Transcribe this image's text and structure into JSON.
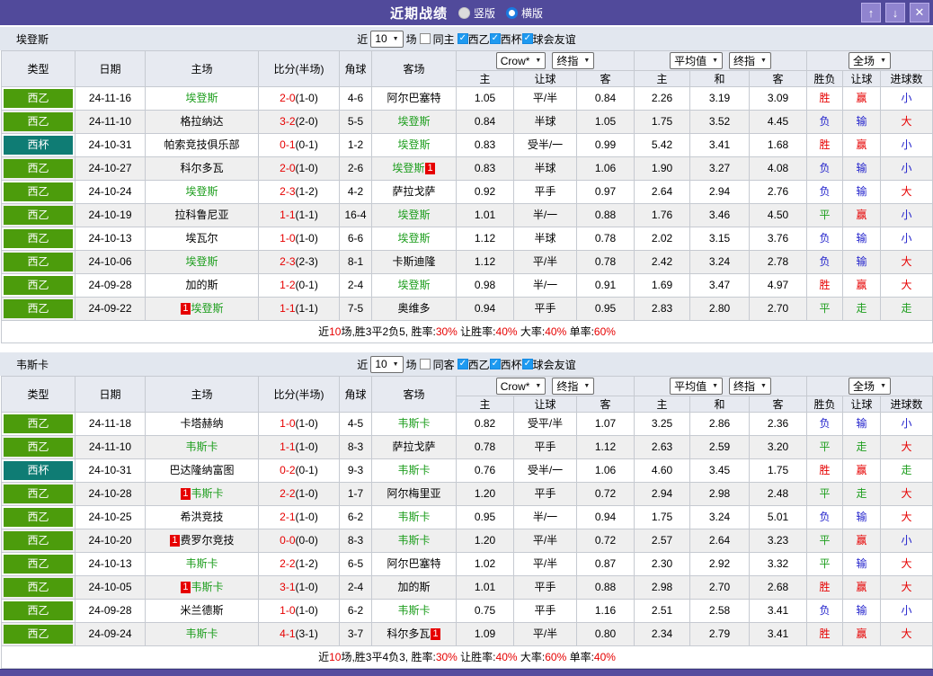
{
  "window": {
    "title": "近期战绩",
    "layout_options": [
      {
        "label": "竖版",
        "selected": false
      },
      {
        "label": "横版",
        "selected": true
      }
    ],
    "buttons": {
      "up": "↑",
      "down": "↓",
      "close": "✕"
    }
  },
  "header_labels": {
    "type": "类型",
    "date": "日期",
    "home": "主场",
    "score": "比分(半场)",
    "corner": "角球",
    "away": "客场",
    "odds_home": "主",
    "odds_handicap": "让球",
    "odds_away": "客",
    "avg_home": "主",
    "avg_draw": "和",
    "avg_away": "客",
    "result": "胜负",
    "handicap": "让球",
    "goals": "进球数"
  },
  "colors": {
    "accent_purple": "#514a9b",
    "league_green": "#4c9c0c",
    "cup_teal": "#0f7c74",
    "win_red": "#e60000",
    "draw_green": "#1e9e1e",
    "lose_blue": "#2323cc",
    "odds_bg": "#fdf8f1",
    "avg_bg": "#e9f4fa",
    "checkbox_blue": "#1e9af0"
  },
  "tables": [
    {
      "team": "埃登斯",
      "filter": {
        "near": "近",
        "count": "10",
        "matches": "场",
        "same": {
          "label": "同主",
          "checked": false
        },
        "leagues": [
          {
            "label": "西乙",
            "checked": true
          },
          {
            "label": "西杯",
            "checked": true
          },
          {
            "label": "球会友谊",
            "checked": true
          }
        ]
      },
      "selects": {
        "odds_company": "Crow*",
        "odds_time": "终指",
        "avg_source": "平均值",
        "avg_time": "终指",
        "scope": "全场"
      },
      "rows": [
        {
          "type": "西乙",
          "cup": false,
          "date": "24-11-16",
          "home": "埃登斯",
          "home_green": true,
          "away": "阿尔巴塞特",
          "away_green": false,
          "score": "2-0",
          "half": "(1-0)",
          "corner": "4-6",
          "odds": [
            "1.05",
            "平/半",
            "0.84"
          ],
          "avg": [
            "2.26",
            "3.19",
            "3.09"
          ],
          "results": [
            [
              "胜",
              "r"
            ],
            [
              "赢",
              "r"
            ],
            [
              "小",
              "b"
            ]
          ]
        },
        {
          "type": "西乙",
          "cup": false,
          "date": "24-11-10",
          "home": "格拉纳达",
          "home_green": false,
          "away": "埃登斯",
          "away_green": true,
          "score": "3-2",
          "half": "(2-0)",
          "corner": "5-5",
          "odds": [
            "0.84",
            "半球",
            "1.05"
          ],
          "avg": [
            "1.75",
            "3.52",
            "4.45"
          ],
          "results": [
            [
              "负",
              "b"
            ],
            [
              "输",
              "b"
            ],
            [
              "大",
              "r"
            ]
          ]
        },
        {
          "type": "西杯",
          "cup": true,
          "date": "24-10-31",
          "home": "帕索竞技俱乐部",
          "home_green": false,
          "away": "埃登斯",
          "away_green": true,
          "score": "0-1",
          "half": "(0-1)",
          "corner": "1-2",
          "odds": [
            "0.83",
            "受半/一",
            "0.99"
          ],
          "avg": [
            "5.42",
            "3.41",
            "1.68"
          ],
          "results": [
            [
              "胜",
              "r"
            ],
            [
              "赢",
              "r"
            ],
            [
              "小",
              "b"
            ]
          ]
        },
        {
          "type": "西乙",
          "cup": false,
          "date": "24-10-27",
          "home": "科尔多瓦",
          "home_green": false,
          "away": "埃登斯",
          "away_green": true,
          "away_card_post": "1",
          "score": "2-0",
          "half": "(1-0)",
          "corner": "2-6",
          "odds": [
            "0.83",
            "半球",
            "1.06"
          ],
          "avg": [
            "1.90",
            "3.27",
            "4.08"
          ],
          "results": [
            [
              "负",
              "b"
            ],
            [
              "输",
              "b"
            ],
            [
              "小",
              "b"
            ]
          ]
        },
        {
          "type": "西乙",
          "cup": false,
          "date": "24-10-24",
          "home": "埃登斯",
          "home_green": true,
          "away": "萨拉戈萨",
          "away_green": false,
          "score": "2-3",
          "half": "(1-2)",
          "corner": "4-2",
          "odds": [
            "0.92",
            "平手",
            "0.97"
          ],
          "avg": [
            "2.64",
            "2.94",
            "2.76"
          ],
          "results": [
            [
              "负",
              "b"
            ],
            [
              "输",
              "b"
            ],
            [
              "大",
              "r"
            ]
          ]
        },
        {
          "type": "西乙",
          "cup": false,
          "date": "24-10-19",
          "home": "拉科鲁尼亚",
          "home_green": false,
          "away": "埃登斯",
          "away_green": true,
          "score": "1-1",
          "half": "(1-1)",
          "corner": "16-4",
          "odds": [
            "1.01",
            "半/一",
            "0.88"
          ],
          "avg": [
            "1.76",
            "3.46",
            "4.50"
          ],
          "results": [
            [
              "平",
              "g"
            ],
            [
              "赢",
              "r"
            ],
            [
              "小",
              "b"
            ]
          ]
        },
        {
          "type": "西乙",
          "cup": false,
          "date": "24-10-13",
          "home": "埃瓦尔",
          "home_green": false,
          "away": "埃登斯",
          "away_green": true,
          "score": "1-0",
          "half": "(1-0)",
          "corner": "6-6",
          "odds": [
            "1.12",
            "半球",
            "0.78"
          ],
          "avg": [
            "2.02",
            "3.15",
            "3.76"
          ],
          "results": [
            [
              "负",
              "b"
            ],
            [
              "输",
              "b"
            ],
            [
              "小",
              "b"
            ]
          ]
        },
        {
          "type": "西乙",
          "cup": false,
          "date": "24-10-06",
          "home": "埃登斯",
          "home_green": true,
          "away": "卡斯迪隆",
          "away_green": false,
          "score": "2-3",
          "half": "(2-3)",
          "corner": "8-1",
          "odds": [
            "1.12",
            "平/半",
            "0.78"
          ],
          "avg": [
            "2.42",
            "3.24",
            "2.78"
          ],
          "results": [
            [
              "负",
              "b"
            ],
            [
              "输",
              "b"
            ],
            [
              "大",
              "r"
            ]
          ]
        },
        {
          "type": "西乙",
          "cup": false,
          "date": "24-09-28",
          "home": "加的斯",
          "home_green": false,
          "away": "埃登斯",
          "away_green": true,
          "score": "1-2",
          "half": "(0-1)",
          "corner": "2-4",
          "odds": [
            "0.98",
            "半/一",
            "0.91"
          ],
          "avg": [
            "1.69",
            "3.47",
            "4.97"
          ],
          "results": [
            [
              "胜",
              "r"
            ],
            [
              "赢",
              "r"
            ],
            [
              "大",
              "r"
            ]
          ]
        },
        {
          "type": "西乙",
          "cup": false,
          "date": "24-09-22",
          "home": "埃登斯",
          "home_green": true,
          "home_card_pre": "1",
          "away": "奥维多",
          "away_green": false,
          "score": "1-1",
          "half": "(1-1)",
          "corner": "7-5",
          "odds": [
            "0.94",
            "平手",
            "0.95"
          ],
          "avg": [
            "2.83",
            "2.80",
            "2.70"
          ],
          "results": [
            [
              "平",
              "g"
            ],
            [
              "走",
              "g"
            ],
            [
              "走",
              "g"
            ]
          ]
        }
      ],
      "summary": [
        [
          "近",
          "k"
        ],
        [
          "10",
          "r"
        ],
        [
          "场,胜3平2负5, 胜率:",
          "k"
        ],
        [
          "30%",
          "r"
        ],
        [
          " 让胜率:",
          "k"
        ],
        [
          "40%",
          "r"
        ],
        [
          " 大率:",
          "k"
        ],
        [
          "40%",
          "r"
        ],
        [
          " 单率:",
          "k"
        ],
        [
          "60%",
          "r"
        ]
      ]
    },
    {
      "team": "韦斯卡",
      "filter": {
        "near": "近",
        "count": "10",
        "matches": "场",
        "same": {
          "label": "同客",
          "checked": false
        },
        "leagues": [
          {
            "label": "西乙",
            "checked": true
          },
          {
            "label": "西杯",
            "checked": true
          },
          {
            "label": "球会友谊",
            "checked": true
          }
        ]
      },
      "selects": {
        "odds_company": "Crow*",
        "odds_time": "终指",
        "avg_source": "平均值",
        "avg_time": "终指",
        "scope": "全场"
      },
      "rows": [
        {
          "type": "西乙",
          "cup": false,
          "date": "24-11-18",
          "home": "卡塔赫纳",
          "home_green": false,
          "away": "韦斯卡",
          "away_green": true,
          "score": "1-0",
          "half": "(1-0)",
          "corner": "4-5",
          "odds": [
            "0.82",
            "受平/半",
            "1.07"
          ],
          "avg": [
            "3.25",
            "2.86",
            "2.36"
          ],
          "results": [
            [
              "负",
              "b"
            ],
            [
              "输",
              "b"
            ],
            [
              "小",
              "b"
            ]
          ]
        },
        {
          "type": "西乙",
          "cup": false,
          "date": "24-11-10",
          "home": "韦斯卡",
          "home_green": true,
          "away": "萨拉戈萨",
          "away_green": false,
          "score": "1-1",
          "half": "(1-0)",
          "corner": "8-3",
          "odds": [
            "0.78",
            "平手",
            "1.12"
          ],
          "avg": [
            "2.63",
            "2.59",
            "3.20"
          ],
          "results": [
            [
              "平",
              "g"
            ],
            [
              "走",
              "g"
            ],
            [
              "大",
              "r"
            ]
          ]
        },
        {
          "type": "西杯",
          "cup": true,
          "date": "24-10-31",
          "home": "巴达隆纳富图",
          "home_green": false,
          "away": "韦斯卡",
          "away_green": true,
          "score": "0-2",
          "half": "(0-1)",
          "corner": "9-3",
          "odds": [
            "0.76",
            "受半/一",
            "1.06"
          ],
          "avg": [
            "4.60",
            "3.45",
            "1.75"
          ],
          "results": [
            [
              "胜",
              "r"
            ],
            [
              "赢",
              "r"
            ],
            [
              "走",
              "g"
            ]
          ]
        },
        {
          "type": "西乙",
          "cup": false,
          "date": "24-10-28",
          "home": "韦斯卡",
          "home_green": true,
          "home_card_pre": "1",
          "away": "阿尔梅里亚",
          "away_green": false,
          "score": "2-2",
          "half": "(1-0)",
          "corner": "1-7",
          "odds": [
            "1.20",
            "平手",
            "0.72"
          ],
          "avg": [
            "2.94",
            "2.98",
            "2.48"
          ],
          "results": [
            [
              "平",
              "g"
            ],
            [
              "走",
              "g"
            ],
            [
              "大",
              "r"
            ]
          ]
        },
        {
          "type": "西乙",
          "cup": false,
          "date": "24-10-25",
          "home": "希洪竞技",
          "home_green": false,
          "away": "韦斯卡",
          "away_green": true,
          "score": "2-1",
          "half": "(1-0)",
          "corner": "6-2",
          "odds": [
            "0.95",
            "半/一",
            "0.94"
          ],
          "avg": [
            "1.75",
            "3.24",
            "5.01"
          ],
          "results": [
            [
              "负",
              "b"
            ],
            [
              "输",
              "b"
            ],
            [
              "大",
              "r"
            ]
          ]
        },
        {
          "type": "西乙",
          "cup": false,
          "date": "24-10-20",
          "home": "费罗尔竞技",
          "home_green": false,
          "home_card_pre": "1",
          "away": "韦斯卡",
          "away_green": true,
          "score": "0-0",
          "half": "(0-0)",
          "corner": "8-3",
          "odds": [
            "1.20",
            "平/半",
            "0.72"
          ],
          "avg": [
            "2.57",
            "2.64",
            "3.23"
          ],
          "results": [
            [
              "平",
              "g"
            ],
            [
              "赢",
              "r"
            ],
            [
              "小",
              "b"
            ]
          ]
        },
        {
          "type": "西乙",
          "cup": false,
          "date": "24-10-13",
          "home": "韦斯卡",
          "home_green": true,
          "away": "阿尔巴塞特",
          "away_green": false,
          "score": "2-2",
          "half": "(1-2)",
          "corner": "6-5",
          "odds": [
            "1.02",
            "平/半",
            "0.87"
          ],
          "avg": [
            "2.30",
            "2.92",
            "3.32"
          ],
          "results": [
            [
              "平",
              "g"
            ],
            [
              "输",
              "b"
            ],
            [
              "大",
              "r"
            ]
          ]
        },
        {
          "type": "西乙",
          "cup": false,
          "date": "24-10-05",
          "home": "韦斯卡",
          "home_green": true,
          "home_card_pre": "1",
          "away": "加的斯",
          "away_green": false,
          "score": "3-1",
          "half": "(1-0)",
          "corner": "2-4",
          "odds": [
            "1.01",
            "平手",
            "0.88"
          ],
          "avg": [
            "2.98",
            "2.70",
            "2.68"
          ],
          "results": [
            [
              "胜",
              "r"
            ],
            [
              "赢",
              "r"
            ],
            [
              "大",
              "r"
            ]
          ]
        },
        {
          "type": "西乙",
          "cup": false,
          "date": "24-09-28",
          "home": "米兰德斯",
          "home_green": false,
          "away": "韦斯卡",
          "away_green": true,
          "score": "1-0",
          "half": "(1-0)",
          "corner": "6-2",
          "odds": [
            "0.75",
            "平手",
            "1.16"
          ],
          "avg": [
            "2.51",
            "2.58",
            "3.41"
          ],
          "results": [
            [
              "负",
              "b"
            ],
            [
              "输",
              "b"
            ],
            [
              "小",
              "b"
            ]
          ]
        },
        {
          "type": "西乙",
          "cup": false,
          "date": "24-09-24",
          "home": "韦斯卡",
          "home_green": true,
          "away": "科尔多瓦",
          "away_green": false,
          "away_card_post": "1",
          "score": "4-1",
          "half": "(3-1)",
          "corner": "3-7",
          "odds": [
            "1.09",
            "平/半",
            "0.80"
          ],
          "avg": [
            "2.34",
            "2.79",
            "3.41"
          ],
          "results": [
            [
              "胜",
              "r"
            ],
            [
              "赢",
              "r"
            ],
            [
              "大",
              "r"
            ]
          ]
        }
      ],
      "summary": [
        [
          "近",
          "k"
        ],
        [
          "10",
          "r"
        ],
        [
          "场,胜3平4负3, 胜率:",
          "k"
        ],
        [
          "30%",
          "r"
        ],
        [
          " 让胜率:",
          "k"
        ],
        [
          "40%",
          "r"
        ],
        [
          " 大率:",
          "k"
        ],
        [
          "60%",
          "r"
        ],
        [
          " 单率:",
          "k"
        ],
        [
          "40%",
          "r"
        ]
      ]
    }
  ]
}
